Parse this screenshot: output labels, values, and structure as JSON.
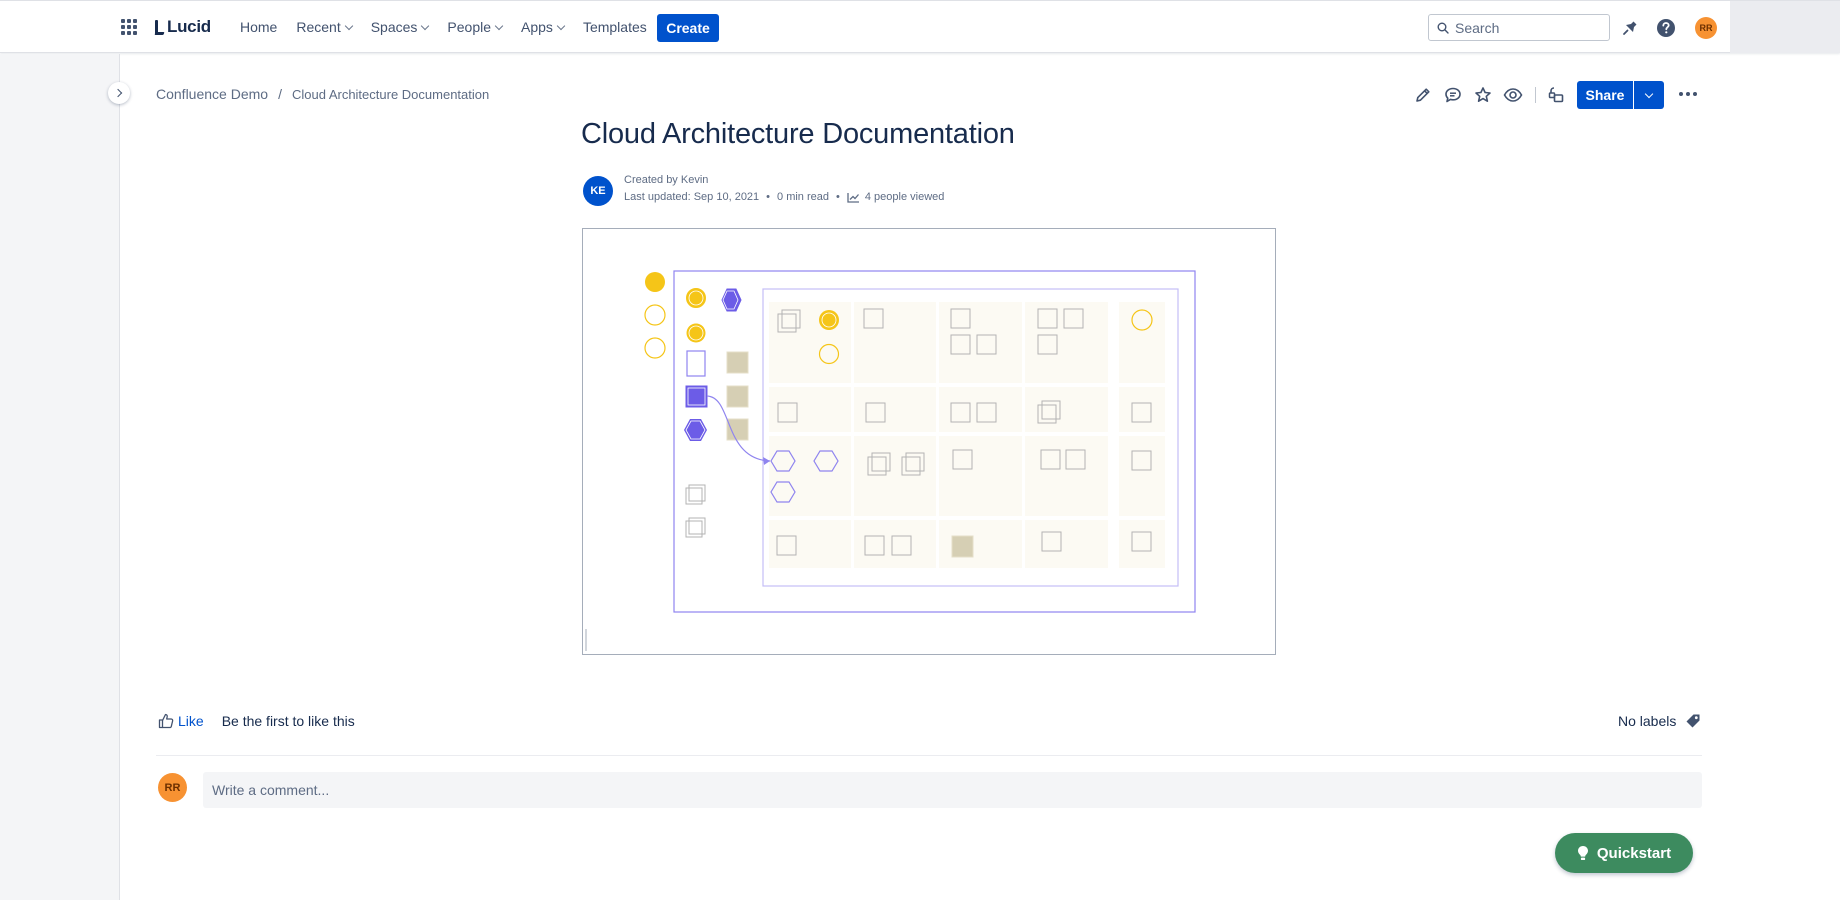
{
  "topbar": {
    "logo": "Lucid",
    "nav": [
      {
        "label": "Home",
        "dropdown": false
      },
      {
        "label": "Recent",
        "dropdown": true
      },
      {
        "label": "Spaces",
        "dropdown": true
      },
      {
        "label": "People",
        "dropdown": true
      },
      {
        "label": "Apps",
        "dropdown": true
      },
      {
        "label": "Templates",
        "dropdown": false
      }
    ],
    "create_label": "Create",
    "search_placeholder": "Search",
    "user_initials": "RR"
  },
  "page": {
    "breadcrumb": {
      "space": "Confluence Demo",
      "separator": "/",
      "current": "Cloud Architecture Documentation"
    },
    "share_label": "Share",
    "title": "Cloud Architecture Documentation",
    "author_initials": "KE",
    "created_by": "Created by Kevin",
    "last_updated": "Last updated: Sep 10, 2021",
    "read_time": "0 min read",
    "views": "4 people viewed"
  },
  "footer": {
    "like_label": "Like",
    "like_text": "Be the first to like this",
    "labels_text": "No labels",
    "commenter_initials": "RR",
    "comment_placeholder": "Write a comment..."
  },
  "quickstart_label": "Quickstart",
  "colors": {
    "primary": "#0052cc",
    "diagram_yellow": "#f5c518",
    "diagram_purple": "#6c5ce7",
    "diagram_tan": "#d6cfb4",
    "quickstart": "#3d8b5f",
    "avatar_orange": "#f79232"
  },
  "icons": [
    "app-switcher-icon",
    "notifications-icon",
    "help-icon",
    "search-icon",
    "edit-icon",
    "comment-icon",
    "star-icon",
    "watch-icon",
    "restrictions-icon",
    "like-icon",
    "label-icon",
    "lightbulb-icon",
    "chart-icon"
  ]
}
